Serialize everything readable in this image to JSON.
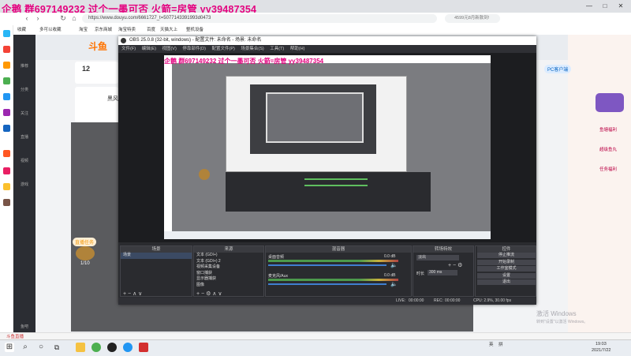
{
  "overlay": {
    "text": "企鹅 群697149232 过个一墨可否 火箭=房管 yy39487354"
  },
  "browser": {
    "url": "https://www.douyu.com/6661727_t=5077143391993d0473",
    "search_placeholder": "4599元8月新款到!",
    "bookmarks": [
      "收藏",
      "多可以收藏",
      "淘宝",
      "京东商城",
      "淘宝特卖",
      "百度",
      "天猫大上",
      "整机设备"
    ],
    "win_controls": [
      "—",
      "□",
      "✕"
    ]
  },
  "douyu": {
    "logo": "斗鱼",
    "sidebar": [
      "推荐",
      "分类",
      "关注",
      "直播",
      "视频",
      "游戏",
      "鱼吧"
    ],
    "follow_count": "12",
    "profile_name": "黑风",
    "pc_badge": "PC客户端",
    "video_counter": "1/10",
    "video_tag": "直播任务",
    "right_texts": [
      "鱼塘福利",
      "超级鱼丸",
      "任务福利"
    ]
  },
  "obs": {
    "title": "OBS 25.0.8 (32-bit, windows) - 配置文件: 未命名 - 场景: 未命名",
    "menu": [
      "文件(F)",
      "编辑(E)",
      "视图(V)",
      "停靠部件(D)",
      "配置文件(P)",
      "场景集合(S)",
      "工具(T)",
      "帮助(H)"
    ],
    "overlay_in_preview": "企鹅 群697149232 过个一墨可否 火箭=房管 yy39487354",
    "docks": {
      "scenes_title": "场景",
      "sources_title": "来源",
      "mixer_title": "混音器",
      "transitions_title": "转场特效",
      "controls_title": "控件"
    },
    "scenes": [
      "场景"
    ],
    "sources": [
      "文本 (GDI+)",
      "文本 (GDI+) 2",
      "视频采集设备",
      "窗口捕获",
      "显示器捕获",
      "图像"
    ],
    "mixer": [
      {
        "name": "桌面音频",
        "level": "0.0 dB"
      },
      {
        "name": "麦克风/Aux",
        "level": "0.0 dB"
      }
    ],
    "transition": {
      "type": "淡出",
      "duration_label": "时长",
      "duration": "300 ms"
    },
    "controls": [
      "停止推流",
      "开始录制",
      "工作室模式",
      "设置",
      "退出"
    ],
    "status": {
      "live_label": "LIVE:",
      "live_time": "00:00:00",
      "rec_label": "REC:",
      "rec_time": "00:00:00",
      "cpu": "CPU: 2.9%, 30.00 fps"
    }
  },
  "taskbar": {
    "tab_title": "斗鱼直播",
    "tray_items": [
      "英",
      "拼"
    ],
    "time": "19:03",
    "date": "2021/7/22"
  },
  "watermark": {
    "title": "激活 Windows",
    "subtitle": "转到\"设置\"以激活 Windows。"
  }
}
